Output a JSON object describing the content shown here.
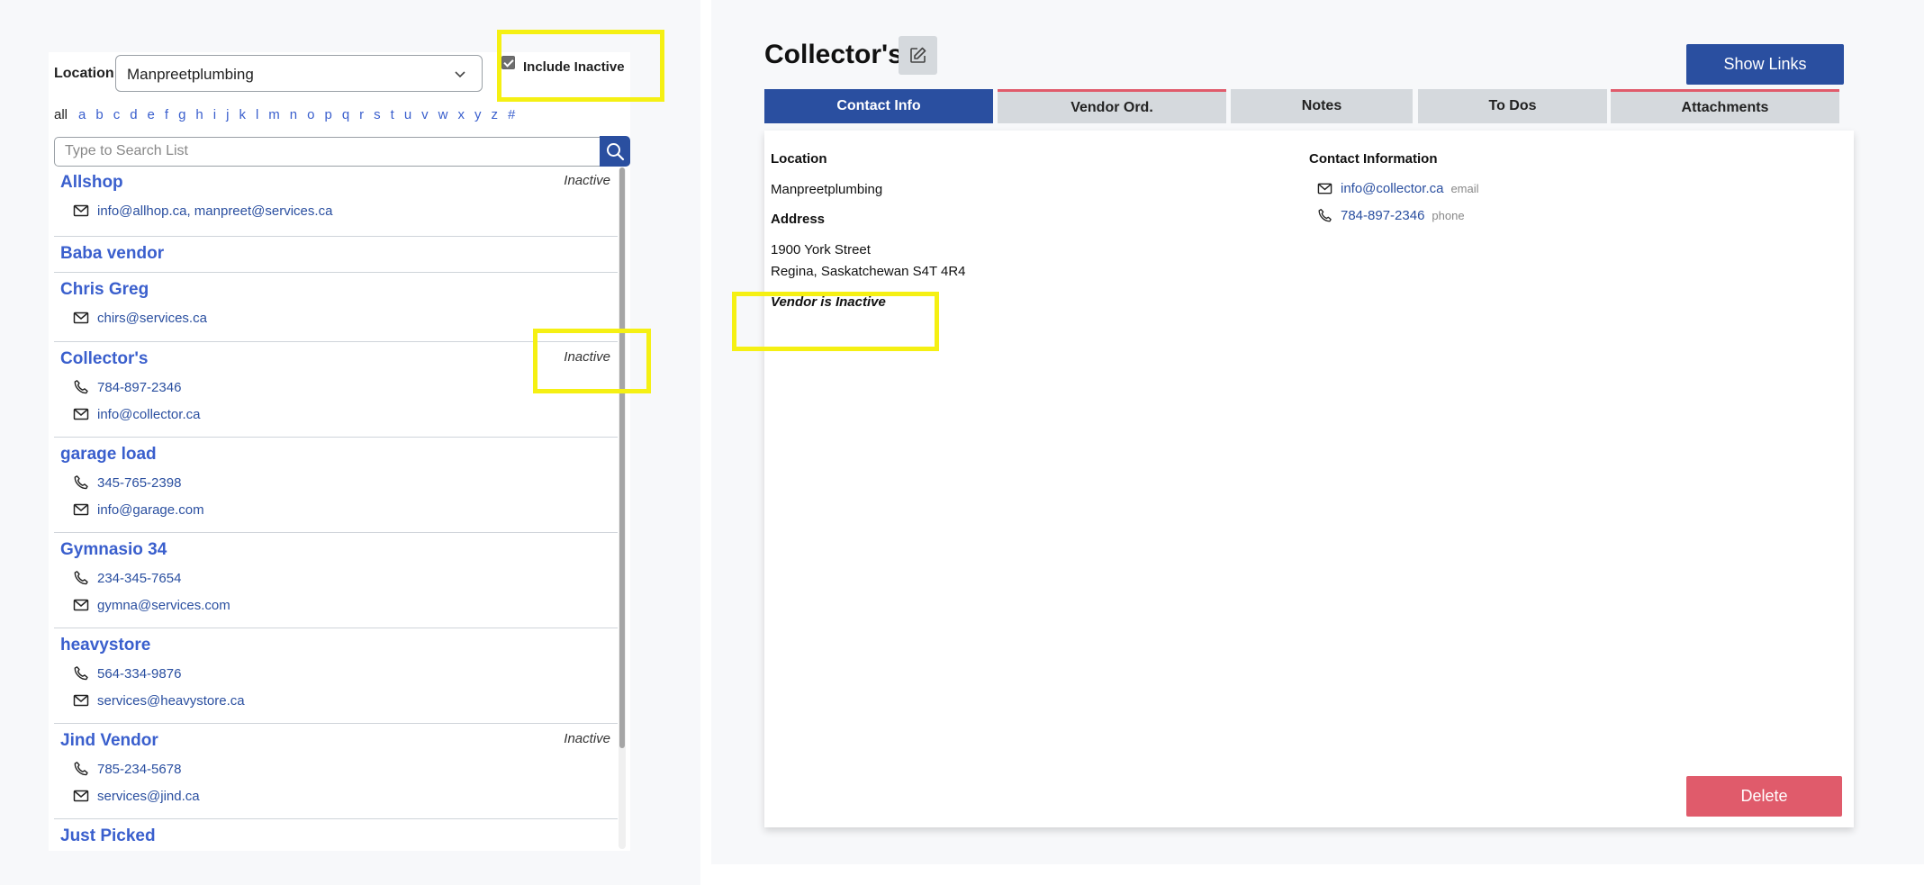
{
  "filters": {
    "location_label": "Location",
    "location_value": "Manpreetplumbing",
    "include_inactive_label": "Include Inactive",
    "include_inactive_checked": true
  },
  "alphabet": [
    "all",
    "a",
    "b",
    "c",
    "d",
    "e",
    "f",
    "g",
    "h",
    "i",
    "j",
    "k",
    "l",
    "m",
    "n",
    "o",
    "p",
    "q",
    "r",
    "s",
    "t",
    "u",
    "v",
    "w",
    "x",
    "y",
    "z",
    "#"
  ],
  "search": {
    "placeholder": "Type to Search List"
  },
  "vendors": [
    {
      "name": "Allshop",
      "inactive": "Inactive",
      "lines": [
        {
          "icon": "mail-icon",
          "value": "info@allhop.ca, manpreet@services.ca"
        }
      ]
    },
    {
      "name": "Baba vendor",
      "inactive": "",
      "lines": []
    },
    {
      "name": "Chris Greg",
      "inactive": "",
      "lines": [
        {
          "icon": "mail-icon",
          "value": "chirs@services.ca"
        }
      ]
    },
    {
      "name": "Collector's",
      "inactive": "Inactive",
      "lines": [
        {
          "icon": "phone-icon",
          "value": "784-897-2346"
        },
        {
          "icon": "mail-icon",
          "value": "info@collector.ca"
        }
      ]
    },
    {
      "name": "garage load",
      "inactive": "",
      "lines": [
        {
          "icon": "phone-icon",
          "value": "345-765-2398"
        },
        {
          "icon": "mail-icon",
          "value": "info@garage.com"
        }
      ]
    },
    {
      "name": "Gymnasio 34",
      "inactive": "",
      "lines": [
        {
          "icon": "phone-icon",
          "value": "234-345-7654"
        },
        {
          "icon": "mail-icon",
          "value": "gymna@services.com"
        }
      ]
    },
    {
      "name": "heavystore",
      "inactive": "",
      "lines": [
        {
          "icon": "phone-icon",
          "value": "564-334-9876"
        },
        {
          "icon": "mail-icon",
          "value": "services@heavystore.ca"
        }
      ]
    },
    {
      "name": "Jind Vendor",
      "inactive": "Inactive",
      "lines": [
        {
          "icon": "phone-icon",
          "value": "785-234-5678"
        },
        {
          "icon": "mail-icon",
          "value": "services@jind.ca"
        }
      ]
    },
    {
      "name": "Just Picked",
      "inactive": "",
      "lines": []
    }
  ],
  "detail": {
    "title": "Collector's",
    "show_links_label": "Show Links",
    "tabs": [
      {
        "label": "Contact Info",
        "active": true
      },
      {
        "label": "Vendor Ord.",
        "active": false
      },
      {
        "label": "Notes",
        "active": false
      },
      {
        "label": "To Dos",
        "active": false
      },
      {
        "label": "Attachments",
        "active": false
      }
    ],
    "location_label": "Location",
    "location_value": "Manpreetplumbing",
    "address_label": "Address",
    "address_line1": "1900 York Street",
    "address_line2": "Regina, Saskatchewan S4T 4R4",
    "inactive_notice": "Vendor is Inactive",
    "contact_label": "Contact Information",
    "contacts": [
      {
        "icon": "mail-icon",
        "value": "info@collector.ca",
        "type": "email"
      },
      {
        "icon": "phone-icon",
        "value": "784-897-2346",
        "type": "phone"
      }
    ],
    "delete_label": "Delete"
  },
  "colors": {
    "primary": "#2a4fa0",
    "link": "#3a5fcd",
    "danger": "#e05b6b",
    "highlight": "#f5f013",
    "tab_inactive": "#d5d9dd"
  }
}
